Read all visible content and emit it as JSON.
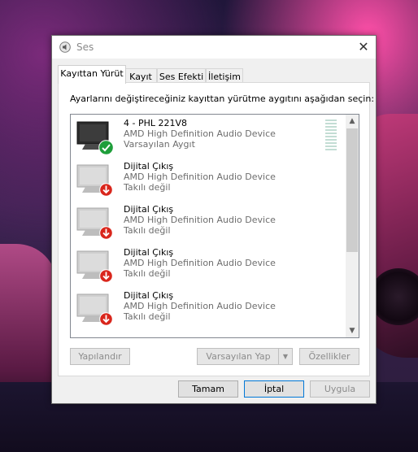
{
  "window": {
    "title": "Ses",
    "close_glyph": "✕"
  },
  "tabs": [
    {
      "label": "Kayıttan Yürüt",
      "active": true
    },
    {
      "label": "Kayıt",
      "active": false
    },
    {
      "label": "Ses Efekti",
      "active": false
    },
    {
      "label": "İletişim",
      "active": false
    }
  ],
  "instruction": "Ayarlarını değiştireceğiniz kayıttan yürütme aygıtını aşağıdan seçin:",
  "devices": [
    {
      "name": "4 - PHL 221V8",
      "description": "AMD High Definition Audio Device",
      "status": "Varsayılan Aygıt",
      "badge": "check-icon",
      "active": true
    },
    {
      "name": "Dijital Çıkış",
      "description": "AMD High Definition Audio Device",
      "status": "Takılı değil",
      "badge": "down-arrow-icon",
      "active": false
    },
    {
      "name": "Dijital Çıkış",
      "description": "AMD High Definition Audio Device",
      "status": "Takılı değil",
      "badge": "down-arrow-icon",
      "active": false
    },
    {
      "name": "Dijital Çıkış",
      "description": "AMD High Definition Audio Device",
      "status": "Takılı değil",
      "badge": "down-arrow-icon",
      "active": false
    },
    {
      "name": "Dijital Çıkış",
      "description": "AMD High Definition Audio Device",
      "status": "Takılı değil",
      "badge": "down-arrow-icon",
      "active": false
    }
  ],
  "buttons": {
    "configure": "Yapılandır",
    "set_default": "Varsayılan Yap",
    "properties": "Özellikler",
    "ok": "Tamam",
    "cancel": "İptal",
    "apply": "Uygula"
  },
  "colors": {
    "default_check": "#1e9e3a",
    "unplugged_badge": "#d9261c",
    "focus_border": "#0078d7"
  }
}
